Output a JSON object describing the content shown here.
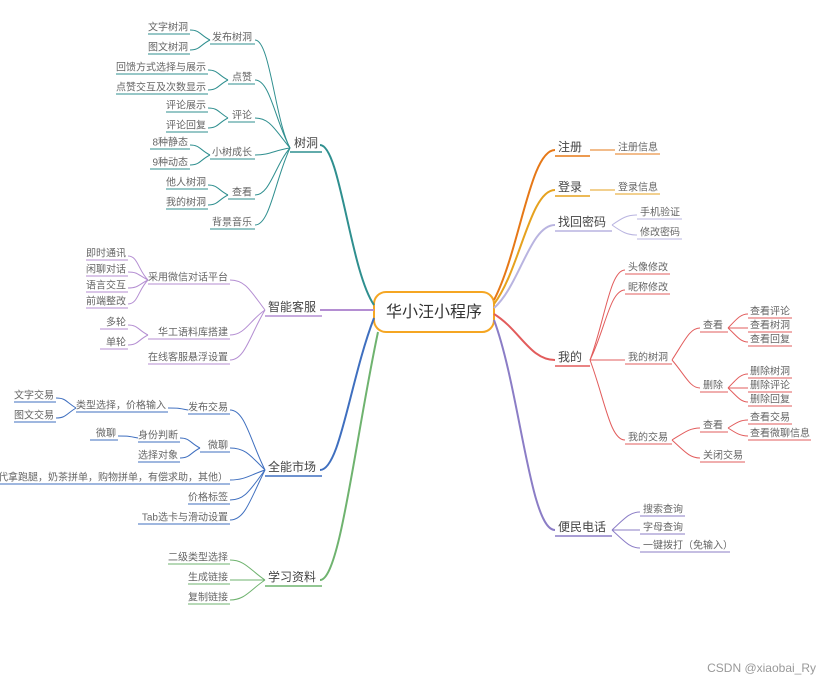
{
  "center": "华小汪小程序",
  "watermark": "CSDN @xiaobai_Ry",
  "branches": {
    "shudong": {
      "label": "树洞",
      "color": "#2f8f8f"
    },
    "kefu": {
      "label": "智能客服",
      "color": "#b48ed2"
    },
    "shichang": {
      "label": "全能市场",
      "color": "#3f6fbf"
    },
    "xuexi": {
      "label": "学习资料",
      "color": "#6fb36f"
    },
    "zhuce": {
      "label": "注册",
      "color": "#e67817"
    },
    "denglu": {
      "label": "登录",
      "color": "#e6a21f"
    },
    "zhaohui": {
      "label": "找回密码",
      "color": "#b9b4e0"
    },
    "wode": {
      "label": "我的",
      "color": "#e25c5c"
    },
    "bianmin": {
      "label": "便民电话",
      "color": "#8b7dc6"
    }
  },
  "sub": {
    "shudong_fabu": "发布树洞",
    "shudong_dianzan": "点赞",
    "shudong_pinglun": "评论",
    "shudong_chengzhang": "小树成长",
    "shudong_chakan": "查看",
    "shudong_bgm": "背景音乐",
    "sd_wen": "文字树洞",
    "sd_tu": "图文树洞",
    "sd_huikui": "回馈方式选择与展示",
    "sd_dzjh": "点赞交互及次数显示",
    "sd_plzs": "评论展示",
    "sd_plhf": "评论回复",
    "sd_8jt": "8种静态",
    "sd_9dt": "9种动态",
    "sd_taren": "他人树洞",
    "sd_wode": "我的树洞",
    "kefu_caiyong": "采用微信对话平台",
    "kefu_yuliao": "华工语料库搭建",
    "kefu_zaixian": "在线客服悬浮设置",
    "kf_jishi": "即时通讯",
    "kf_xianliao": "闲聊对话",
    "kf_yuyin": "语言交互",
    "kf_qianduan": "前端整改",
    "kf_duolun": "多轮",
    "kf_danlun": "单轮",
    "sc_fabu": "发布交易",
    "sc_weiliao": "微聊",
    "sc_biaoqian": "交易标签（二手类，代拿跑腿，奶茶拼单，购物拼单，有偿求助，其他）",
    "sc_jiage": "价格标签",
    "sc_tab": "Tab选卡与滑动设置",
    "sc_leixing": "类型选择，价格输入",
    "sc_wenzi": "文字交易",
    "sc_tuwen": "图文交易",
    "sc_shenfen": "身份判断",
    "sc_xuanze": "选择对象",
    "xx_erji": "二级类型选择",
    "xx_shengcheng": "生成链接",
    "xx_fuzhi": "复制链接",
    "zc_xinxi": "注册信息",
    "dl_xinxi": "登录信息",
    "zh_sj": "手机验证",
    "zh_xg": "修改密码",
    "wd_tx": "头像修改",
    "wd_nc": "昵称修改",
    "wd_sd": "我的树洞",
    "wd_jy": "我的交易",
    "wd_sd_ck": "查看",
    "wd_sd_sc": "删除",
    "wd_sd_ck_pl": "查看评论",
    "wd_sd_ck_sd": "查看树洞",
    "wd_sd_ck_hf": "查看回复",
    "wd_sd_sc_sd": "删除树洞",
    "wd_sd_sc_pl": "删除评论",
    "wd_sd_sc_hf": "删除回复",
    "wd_jy_ck": "查看",
    "wd_jy_ck_jy": "查看交易",
    "wd_jy_ck_wl": "查看微聊信息",
    "wd_jy_gb": "关闭交易",
    "bm_ss": "搜索查询",
    "bm_zm": "字母查询",
    "bm_yj": "一键拨打（免输入）"
  }
}
